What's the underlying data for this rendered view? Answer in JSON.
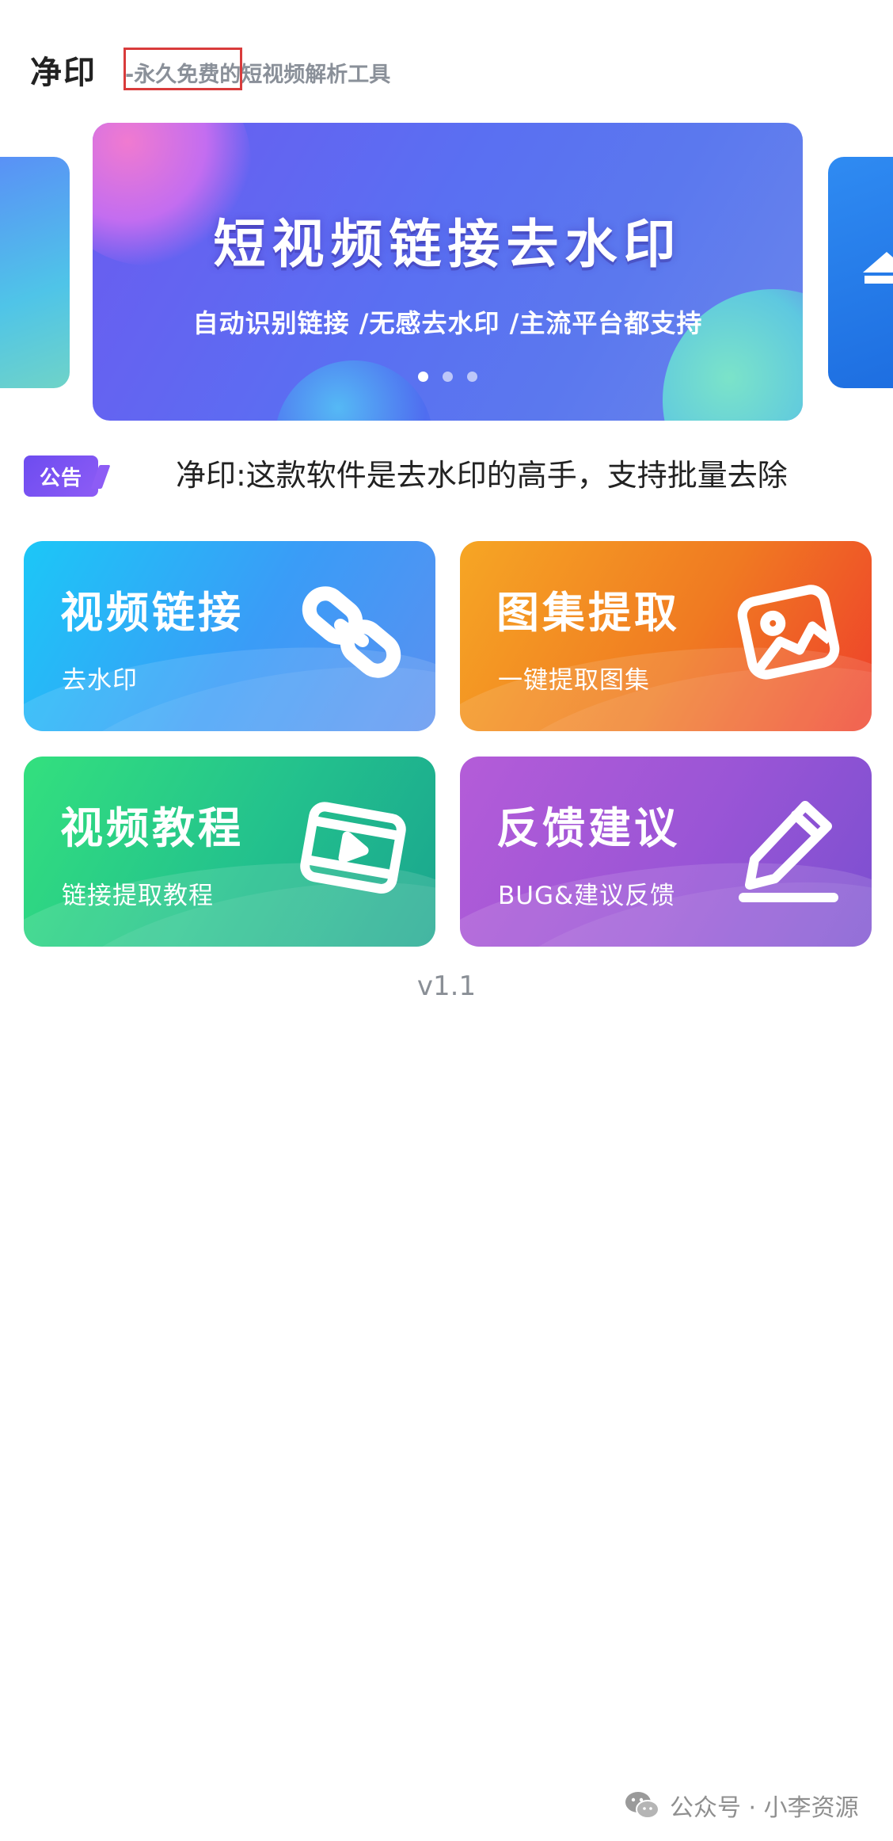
{
  "header": {
    "app_name": "净印",
    "tagline": "-永久免费的短视频解析工具"
  },
  "banner": {
    "title": "短视频链接去水印",
    "subtitle": "自动识别链接 /无感去水印 /主流平台都支持",
    "dots": 3,
    "active_dot": 1
  },
  "notice": {
    "badge": "公告",
    "text": "净印:这款软件是去水印的高手，支持批量去除"
  },
  "cards": [
    {
      "title": "视频链接",
      "subtitle": "去水印",
      "icon": "link-icon"
    },
    {
      "title": "图集提取",
      "subtitle": "一键提取图集",
      "icon": "image-icon"
    },
    {
      "title": "视频教程",
      "subtitle": "链接提取教程",
      "icon": "video-play-icon"
    },
    {
      "title": "反馈建议",
      "subtitle": "BUG&建议反馈",
      "icon": "edit-pen-icon"
    }
  ],
  "version": "v1.1",
  "footer": {
    "text": "公众号 · 小李资源",
    "icon": "wechat-icon"
  },
  "colors": {
    "banner": "#5a6ff2",
    "notice_badge": "#7a52f2",
    "card_video": "#1cc7f7",
    "card_album": "#f07a22",
    "card_tutorial": "#23c18d",
    "card_feedback": "#9a55d6",
    "highlight_box": "#d93b3b"
  }
}
